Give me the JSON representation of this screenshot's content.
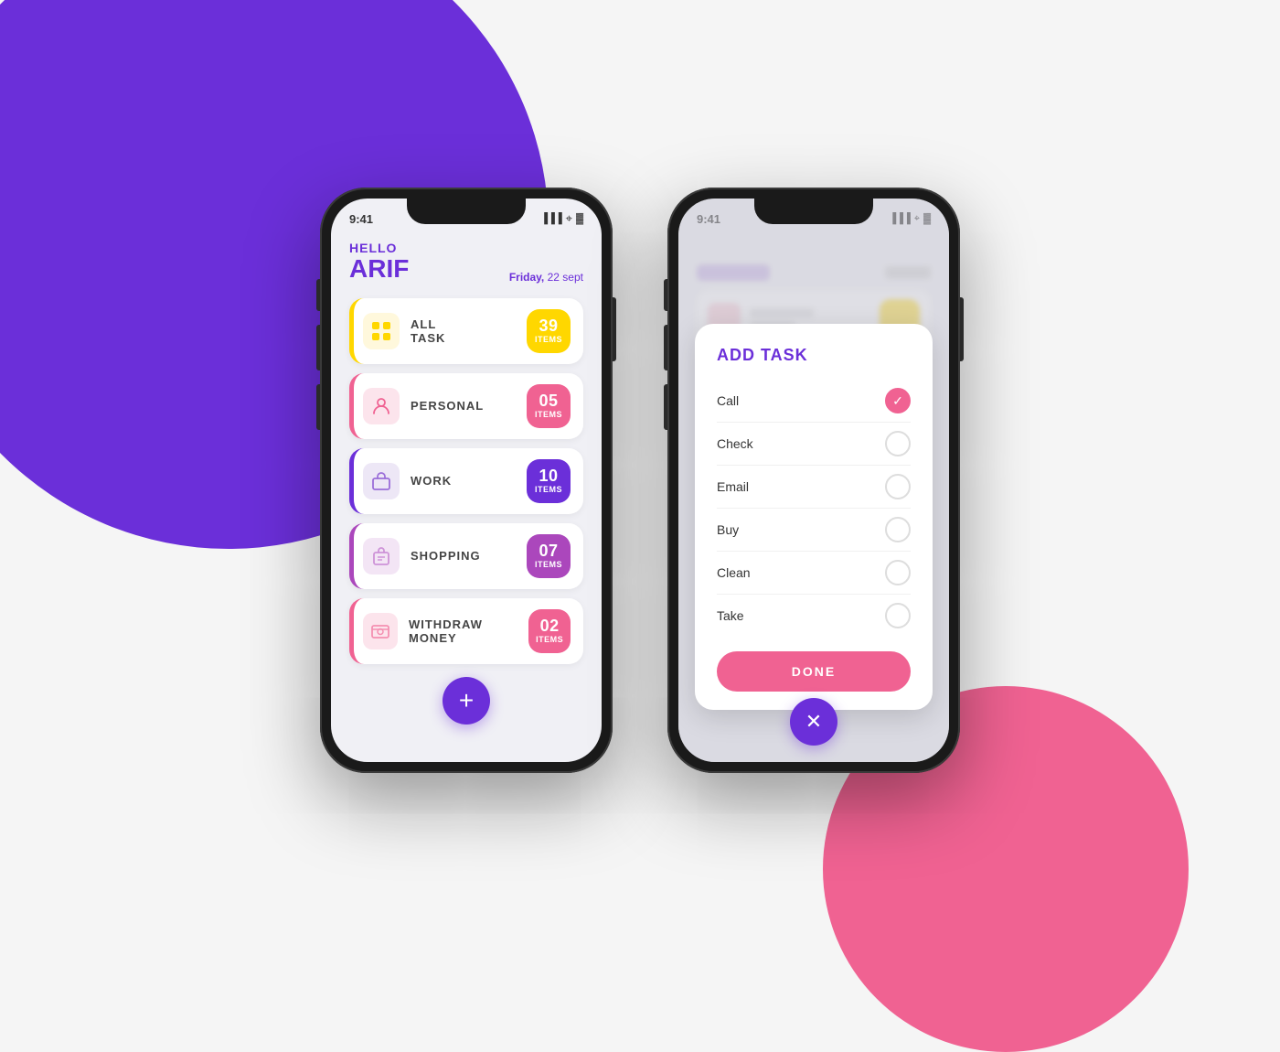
{
  "background": {
    "purple_color": "#6B2FD9",
    "pink_color": "#F06292",
    "yellow_color": "#FFD700"
  },
  "phone1": {
    "status_bar": {
      "time": "9:41",
      "icons": "▐▐▐ ◈ ▓"
    },
    "greeting": {
      "hello": "HELLO",
      "name": "ARIF",
      "date_label": "Friday, 22 sept"
    },
    "tasks": [
      {
        "icon": "⊞",
        "icon_color": "#FFD700",
        "label": "ALL\nTASK",
        "count": "39",
        "count_label": "ITEMS",
        "badge_color": "#FFD700"
      },
      {
        "icon": "👤",
        "icon_color": "#F48FB1",
        "label": "PERSONAL",
        "count": "05",
        "count_label": "ITEMS",
        "badge_color": "#F06292"
      },
      {
        "icon": "💼",
        "icon_color": "#9B6FD9",
        "label": "WORK",
        "count": "10",
        "count_label": "ITEMS",
        "badge_color": "#6B2FD9"
      },
      {
        "icon": "🛒",
        "icon_color": "#CE93D8",
        "label": "SHOPPING",
        "count": "07",
        "count_label": "ITEMS",
        "badge_color": "#AB47BC"
      },
      {
        "icon": "💳",
        "icon_color": "#F48FB1",
        "label": "WITHDRAW MONEY",
        "count": "02",
        "count_label": "ITEMS",
        "badge_color": "#F06292"
      }
    ],
    "add_button": "+"
  },
  "phone2": {
    "status_bar": {
      "time": "9:41"
    },
    "modal": {
      "title": "ADD TASK",
      "items": [
        {
          "label": "Call",
          "checked": true
        },
        {
          "label": "Check",
          "checked": false
        },
        {
          "label": "Email",
          "checked": false
        },
        {
          "label": "Buy",
          "checked": false
        },
        {
          "label": "Clean",
          "checked": false
        },
        {
          "label": "Take",
          "checked": false
        }
      ],
      "done_button": "DONE"
    },
    "close_button": "✕"
  }
}
